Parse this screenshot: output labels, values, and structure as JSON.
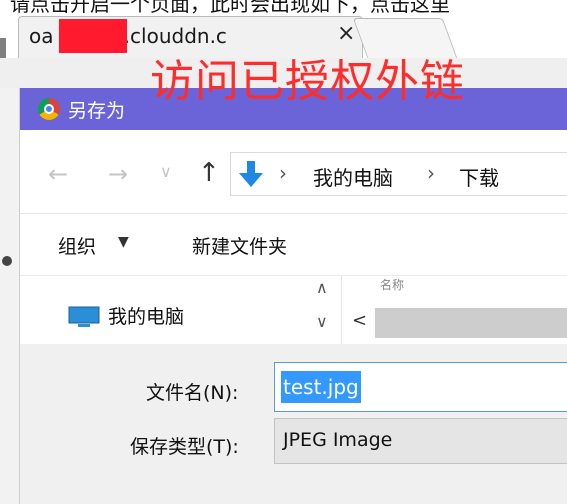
{
  "browser": {
    "top_cut_text": "请点击开启一个页面，此时会出现如下，点击这里",
    "tab_title": "oa        uu.bkt.clouddn.c",
    "tab_close": "×"
  },
  "overlay_caption": "访问已授权外链",
  "dialog": {
    "title": "另存为",
    "nav": {
      "back": "←",
      "forward": "→",
      "recent": "∨",
      "up": "↑",
      "separator": "›",
      "crumbs": [
        "我的电脑",
        "下载"
      ]
    },
    "commands": {
      "organize": "组织",
      "organize_caret": "▼",
      "new_folder": "新建文件夹"
    },
    "nav_pane": {
      "item": "我的电脑",
      "scroll_up": "∧",
      "scroll_down": "∨",
      "h_scroll_left": "<",
      "list_header_partial": "名称"
    },
    "form": {
      "filename_label": "文件名(N):",
      "filename_value": "test.jpg",
      "filetype_label": "保存类型(T):",
      "filetype_value": "JPEG Image"
    }
  },
  "icons": {
    "chrome": "chrome-logo-icon",
    "download": "download-arrow-icon",
    "computer": "computer-icon"
  },
  "colors": {
    "title_bar": "#6b64d8",
    "overlay_text": "#ff2c2c",
    "selection": "#3399ff",
    "download_arrow": "#1e88e5",
    "redaction": "#ff1a2e"
  }
}
